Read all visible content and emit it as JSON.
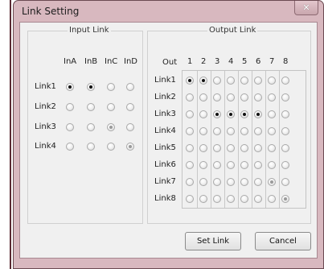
{
  "window": {
    "title": "Link Setting",
    "close_icon": "close-icon",
    "close_glyph": "✕"
  },
  "input_group": {
    "title": "Input Link",
    "columns": [
      "InA",
      "InB",
      "InC",
      "InD"
    ],
    "rows": [
      "Link1",
      "Link2",
      "Link3",
      "Link4"
    ],
    "selected": [
      [
        true,
        true,
        false,
        false
      ],
      [
        false,
        false,
        false,
        false
      ],
      [
        false,
        false,
        false,
        false
      ],
      [
        false,
        false,
        false,
        false
      ]
    ],
    "dimmed": [
      [
        false,
        false,
        false,
        false
      ],
      [
        false,
        false,
        false,
        false
      ],
      [
        false,
        false,
        true,
        false
      ],
      [
        false,
        false,
        false,
        true
      ]
    ]
  },
  "output_group": {
    "title": "Output Link",
    "corner_label": "Out",
    "columns": [
      "1",
      "2",
      "3",
      "4",
      "5",
      "6",
      "7",
      "8"
    ],
    "rows": [
      "Link1",
      "Link2",
      "Link3",
      "Link4",
      "Link5",
      "Link6",
      "Link7",
      "Link8"
    ],
    "selected": [
      [
        true,
        true,
        false,
        false,
        false,
        false,
        false,
        false
      ],
      [
        false,
        false,
        false,
        false,
        false,
        false,
        false,
        false
      ],
      [
        false,
        false,
        true,
        true,
        true,
        true,
        false,
        false
      ],
      [
        false,
        false,
        false,
        false,
        false,
        false,
        false,
        false
      ],
      [
        false,
        false,
        false,
        false,
        false,
        false,
        false,
        false
      ],
      [
        false,
        false,
        false,
        false,
        false,
        false,
        false,
        false
      ],
      [
        false,
        false,
        false,
        false,
        false,
        false,
        false,
        false
      ],
      [
        false,
        false,
        false,
        false,
        false,
        false,
        false,
        false
      ]
    ],
    "dimmed": [
      [
        false,
        false,
        false,
        false,
        false,
        false,
        false,
        false
      ],
      [
        false,
        false,
        false,
        false,
        false,
        false,
        false,
        false
      ],
      [
        false,
        false,
        false,
        false,
        false,
        false,
        false,
        false
      ],
      [
        false,
        false,
        false,
        false,
        false,
        false,
        false,
        false
      ],
      [
        false,
        false,
        false,
        false,
        false,
        false,
        false,
        false
      ],
      [
        false,
        false,
        false,
        false,
        false,
        false,
        false,
        false
      ],
      [
        false,
        false,
        false,
        false,
        false,
        false,
        true,
        false
      ],
      [
        false,
        false,
        false,
        false,
        false,
        false,
        false,
        true
      ]
    ]
  },
  "buttons": {
    "set_link": "Set Link",
    "cancel": "Cancel"
  }
}
